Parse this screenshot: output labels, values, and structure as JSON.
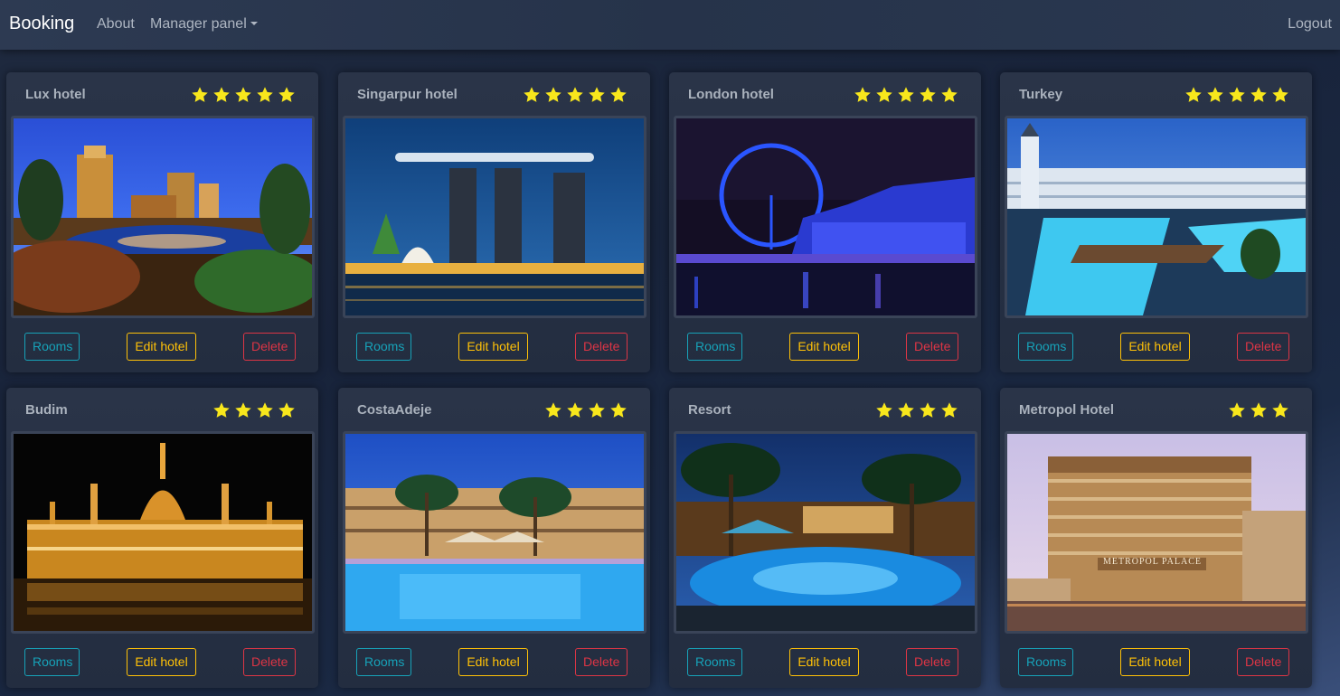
{
  "nav": {
    "brand": "Booking",
    "about": "About",
    "manager_panel": "Manager panel",
    "logout": "Logout"
  },
  "buttons": {
    "rooms": "Rooms",
    "edit": "Edit hotel",
    "delete": "Delete"
  },
  "colors": {
    "star": "#f8e71c",
    "rooms": "#17a2b8",
    "edit": "#ffc107",
    "delete": "#dc3545"
  },
  "hotels": [
    {
      "name": "Lux hotel",
      "stars": 5,
      "image": "las-vegas-night-resort"
    },
    {
      "name": "Singarpur hotel",
      "stars": 5,
      "image": "marina-bay-sands-night"
    },
    {
      "name": "London hotel",
      "stars": 5,
      "image": "london-eye-night"
    },
    {
      "name": "Turkey",
      "stars": 5,
      "image": "turkey-pool-resort"
    },
    {
      "name": "Budim",
      "stars": 4,
      "image": "budapest-parliament-night"
    },
    {
      "name": "CostaAdeje",
      "stars": 4,
      "image": "costa-adeje-pool"
    },
    {
      "name": "Resort",
      "stars": 4,
      "image": "tropical-resort-pool-night"
    },
    {
      "name": "Metropol Hotel",
      "stars": 3,
      "image": "metropol-palace-building",
      "sign_text": "METROPOL PALACE"
    }
  ]
}
